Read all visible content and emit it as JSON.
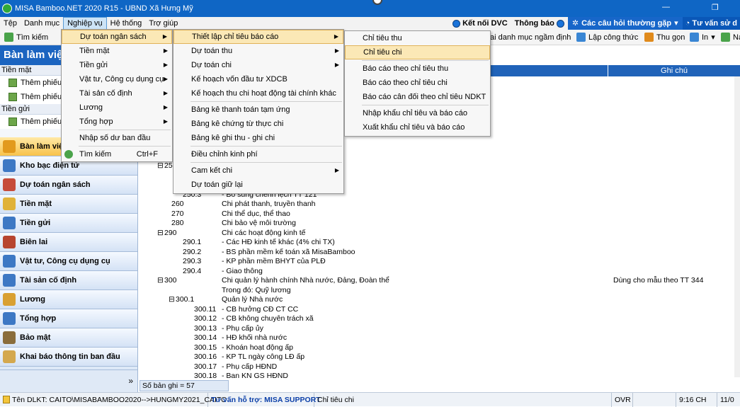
{
  "title": "MISA Bamboo.NET 2020 R15 - UBND Xã Hưng Mỹ",
  "menubar": {
    "items": [
      "Tệp",
      "Danh mục",
      "Nghiệp vụ",
      "Hệ thống",
      "Trợ giúp"
    ],
    "dvc": "Kết nối DVC",
    "notify": "Thông báo",
    "faq": "Các câu hỏi thường gặp",
    "consult": "Tư vấn sử d"
  },
  "toolbar": {
    "search": "Tìm kiếm",
    "catalog": "ai danh mục ngầm định",
    "formula": "Lập công thức",
    "collapse": "Thu gọn",
    "print": "In",
    "na": "Na"
  },
  "sidebar": {
    "title": "Bàn làm việ",
    "group1": "Tiền mặt",
    "sub1a": "Thêm phiếu th",
    "sub1b": "Thêm phiếu c",
    "group2": "Tiền gửi",
    "sub2a": "Thêm phiếu n",
    "buttons": [
      "Bàn làm việ",
      "Kho bạc điện tử",
      "Dự toán ngân sách",
      "Tiền mặt",
      "Tiền gửi",
      "Biên lai",
      "Vật tư, Công cụ dụng cụ",
      "Tài sản cố định",
      "Lương",
      "Tổng hợp",
      "Bảo mật",
      "Khai báo thông tin ban đầu"
    ],
    "chevron": "»"
  },
  "grid": {
    "note_header": "Ghi chú",
    "rows": [
      {
        "code": "250",
        "expander": "⊟",
        "name": ""
      },
      {
        "code": "250.3",
        "expander": "",
        "name": "- Bổ sung chênh lệch TT 121"
      },
      {
        "code": "260",
        "expander": "",
        "name": "Chi phát thanh, truyền thanh"
      },
      {
        "code": "270",
        "expander": "",
        "name": "Chi thể dục, thể thao"
      },
      {
        "code": "280",
        "expander": "",
        "name": "Chi bảo vệ môi trường"
      },
      {
        "code": "290",
        "expander": "⊟",
        "name": "Chi các hoạt động kinh tế"
      },
      {
        "code": "290.1",
        "expander": "",
        "name": "- Các HĐ kinh tế khác (4% chi TX)"
      },
      {
        "code": "290.2",
        "expander": "",
        "name": "- BS phần mềm kế toán xã MisaBamboo"
      },
      {
        "code": "290.3",
        "expander": "",
        "name": "- KP phần mềm BHYT của PLĐ"
      },
      {
        "code": "290.4",
        "expander": "",
        "name": "- Giao thông"
      },
      {
        "code": "300",
        "expander": "⊟",
        "name": "Chi quản lý hành chính Nhà nước, Đảng, Đoàn thể",
        "note": "Dùng cho mẫu theo TT 344"
      },
      {
        "code": "",
        "expander": "",
        "name": "Trong đó: Quỹ lương"
      },
      {
        "code": "300.1",
        "expander": "⊟",
        "name": "Quản lý Nhà nước"
      },
      {
        "code": "300.11",
        "expander": "",
        "name": "- CB hưởng CĐ CT CC"
      },
      {
        "code": "300.12",
        "expander": "",
        "name": "- CB không chuyên trách xã"
      },
      {
        "code": "300.13",
        "expander": "",
        "name": "- Phụ cấp ủy"
      },
      {
        "code": "300.14",
        "expander": "",
        "name": "- HĐ khối nhà nước"
      },
      {
        "code": "300.15",
        "expander": "",
        "name": "- Khoán hoạt động ấp"
      },
      {
        "code": "300.16",
        "expander": "",
        "name": "- KP TL ngày công LĐ ấp"
      },
      {
        "code": "300.17",
        "expander": "",
        "name": "- Phụ cấp HĐND"
      },
      {
        "code": "300.18",
        "expander": "",
        "name": "- Ban KN GS HĐND"
      }
    ],
    "record_count": "Số bản ghi = 57"
  },
  "menu1": {
    "items": [
      "Dự toán ngân sách",
      "Tiền mặt",
      "Tiền gửi",
      "Vật tư, Công cụ dụng cụ",
      "Tài sản cố định",
      "Lương",
      "Tổng hợp",
      "Nhập số dư ban đầu",
      "Tìm kiếm"
    ],
    "search_shortcut": "Ctrl+F"
  },
  "menu2": {
    "items": [
      "Thiết lập chỉ tiêu báo cáo",
      "Dự toán thu",
      "Dự toán chi",
      "Kế hoạch vốn đầu tư XDCB",
      "Kế hoạch thu chi hoạt động tài chính khác",
      "Bảng kê thanh toán tạm ứng",
      "Bảng kê chứng từ thực chi",
      "Bảng kê ghi thu - ghi chi",
      "Điều chỉnh kinh phí",
      "Cam kết chi",
      "Dự toán giữ lại"
    ]
  },
  "menu3": {
    "items": [
      "Chỉ tiêu thu",
      "Chỉ tiêu chi",
      "Báo cáo theo chỉ tiêu thu",
      "Báo cáo theo chỉ tiêu chi",
      "Báo cáo cân đối theo chỉ tiêu NDKT",
      "Nhập khẩu chỉ tiêu và báo cáo",
      "Xuất khẩu chỉ tiêu và báo cáo"
    ]
  },
  "status": {
    "db": "Tên DLKT: CAITO\\MISABAMBOO2020-->HUNGMY2021_CAITO",
    "support": "Tư vấn hỗ trợ: MISA SUPPORT",
    "current": "Chỉ tiêu chi",
    "ovr": "OVR",
    "time": "9:16 CH",
    "date": "11/0"
  }
}
